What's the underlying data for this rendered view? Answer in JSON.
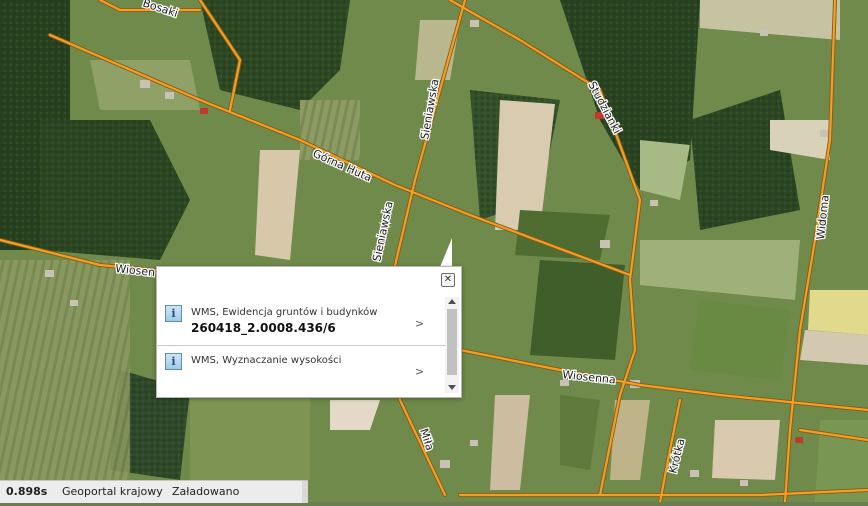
{
  "map": {
    "road_labels": {
      "bosaki": "Bosaki",
      "gorna_huta": "Górna Huta",
      "sieniawska_north": "Sieniawska",
      "sieniawska_south": "Sieniawska",
      "studzianki": "Studzianki",
      "widoma": "Widoma",
      "wiosenna_west": "Wiosen",
      "wiosenna_east": "Wiosenna",
      "mila": "Miła",
      "krotka": "Krótka"
    },
    "colors": {
      "road_fill": "#f0a028",
      "road_casing": "#8a5a12"
    }
  },
  "popup": {
    "close_icon": "close-icon",
    "items": [
      {
        "title": "WMS, Ewidencja gruntów i budynków",
        "value": "260418_2.0008.436/6",
        "icon": "info-icon"
      },
      {
        "title": "WMS, Wyznaczanie wysokości",
        "value": "",
        "icon": "info-icon"
      }
    ]
  },
  "statusbar": {
    "time": "0.898s",
    "source": "Geoportal krajowy",
    "state": "Załadowano"
  }
}
